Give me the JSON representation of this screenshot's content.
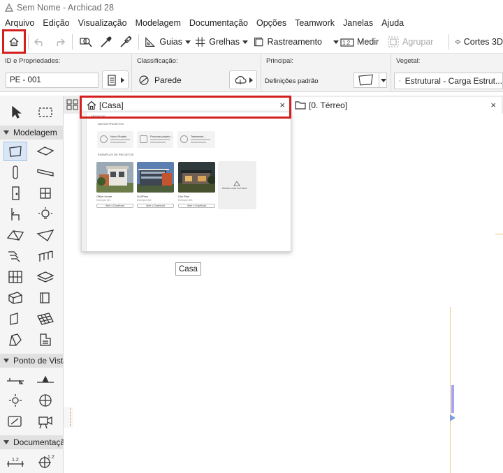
{
  "window": {
    "title": "Sem Nome - Archicad 28"
  },
  "menu": [
    "Arquivo",
    "Edição",
    "Visualização",
    "Modelagem",
    "Documentação",
    "Opções",
    "Teamwork",
    "Janelas",
    "Ajuda"
  ],
  "toolbar": {
    "guides_label": "Guias",
    "grids_label": "Grelhas",
    "tracking_label": "Rastreamento",
    "measure_label": "Medir",
    "group_label": "Agrupar",
    "sections3d_label": "Cortes 3D"
  },
  "infobox": {
    "id_label": "ID e Propriedades:",
    "id_value": "PE - 001",
    "classification_label": "Classificação:",
    "classification_value": "Parede",
    "main_label": "Principal:",
    "main_value": "Definições padrão",
    "vegetal_label": "Vegetal:",
    "vegetal_value": "Estrutural - Carga Estrut..."
  },
  "toolbox": {
    "sections": [
      "Modelagem",
      "Ponto de Vista",
      "Documentação"
    ]
  },
  "tabs": [
    {
      "label": "[Casa]",
      "close": "×"
    },
    {
      "label": "[0. Térreo]",
      "close": "×"
    }
  ],
  "preview": {
    "logo": "ARCHICAD",
    "heading_new": "NOVOS PROJETOS",
    "heading_examples": "EXEMPLOS DE PROJETOS",
    "cards": [
      "Novo Projeto",
      "Procurar projeto...",
      "Teamwork..."
    ],
    "projects": [
      {
        "name": "Office Home",
        "sub": "Exemplo 001",
        "button": "Abrir o Download"
      },
      {
        "name": "GoSPlan",
        "sub": "Exemplo 002",
        "button": "Abrir o Download"
      },
      {
        "name": "Ulio Plan",
        "sub": "Exemplo 003",
        "button": "Abrir o Download"
      }
    ],
    "more_label": "Mostrar mais na Home"
  },
  "tooltip": "Casa",
  "colors": {
    "highlight": "#d41f1f",
    "selection": "#d9e6f6",
    "accent": "#a4a4f0"
  }
}
